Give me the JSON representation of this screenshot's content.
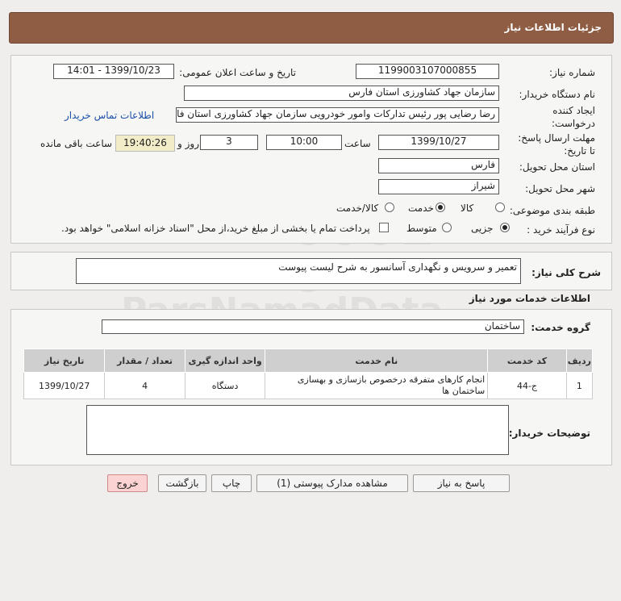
{
  "header": {
    "title": "جزئیات اطلاعات نیاز"
  },
  "form": {
    "need_number_label": "شماره نیاز:",
    "need_number": "1199003107000855",
    "announce_label": "تاریخ و ساعت اعلان عمومی:",
    "announce_value": "1399/10/23 - 14:01",
    "buyer_org_label": "نام دستگاه خریدار:",
    "buyer_org": "سازمان جهاد کشاورزی استان فارس",
    "creator_label_1": "ایجاد کننده",
    "creator_label_2": "درخواست:",
    "creator": "رضا رضایی پور رئیس تدارکات وامور خودرویی سازمان جهاد کشاورزی استان فارس",
    "contact_link": "اطلاعات تماس خریدار",
    "deadline_label_1": "مهلت ارسال پاسخ:",
    "deadline_label_2": "تا تاریخ:",
    "deadline_date": "1399/10/27",
    "time_label": "ساعت",
    "deadline_time": "10:00",
    "days_value": "3",
    "days_label": "روز و",
    "remaining_time": "19:40:26",
    "remaining_label": "ساعت باقی مانده",
    "province_label": "استان محل تحویل:",
    "province": "فارس",
    "city_label": "شهر محل تحویل:",
    "city": "شیراز",
    "category_label": "طبقه بندی موضوعی:",
    "category_options": [
      "کالا",
      "خدمت",
      "کالا/خدمت"
    ],
    "category_selected": "خدمت",
    "purchase_label": "نوع فرآیند خرید :",
    "purchase_options": [
      "جزیی",
      "متوسط"
    ],
    "purchase_selected": "جزیی",
    "payment_note": "پرداخت تمام یا بخشی از مبلغ خرید،از محل \"اسناد خزانه اسلامی\" خواهد بود."
  },
  "summary": {
    "label": "شرح کلی نیاز:",
    "value": "تعمیر و سرویس و نگهداری آسانسور به شرح لیست پیوست"
  },
  "services": {
    "section_title": "اطلاعات خدمات مورد نیاز",
    "group_label": "گروه خدمت:",
    "group_value": "ساختمان",
    "columns": [
      "ردیف",
      "کد خدمت",
      "نام خدمت",
      "واحد اندازه گیری",
      "تعداد / مقدار",
      "تاریخ نیاز"
    ],
    "rows": [
      {
        "row": "1",
        "code": "ج-44",
        "name": "انجام کارهای متفرقه درخصوص بازسازی و بهسازی ساختمان ها",
        "unit": "دستگاه",
        "qty": "4",
        "date": "1399/10/27"
      }
    ]
  },
  "buyer_notes": {
    "label": "توضیحات خریدار:",
    "value": ""
  },
  "buttons": {
    "reply": "پاسخ به نیاز",
    "attachments": "مشاهده مدارک پیوستی (1)",
    "print": "چاپ",
    "back": "بازگشت",
    "exit": "خروج"
  }
}
